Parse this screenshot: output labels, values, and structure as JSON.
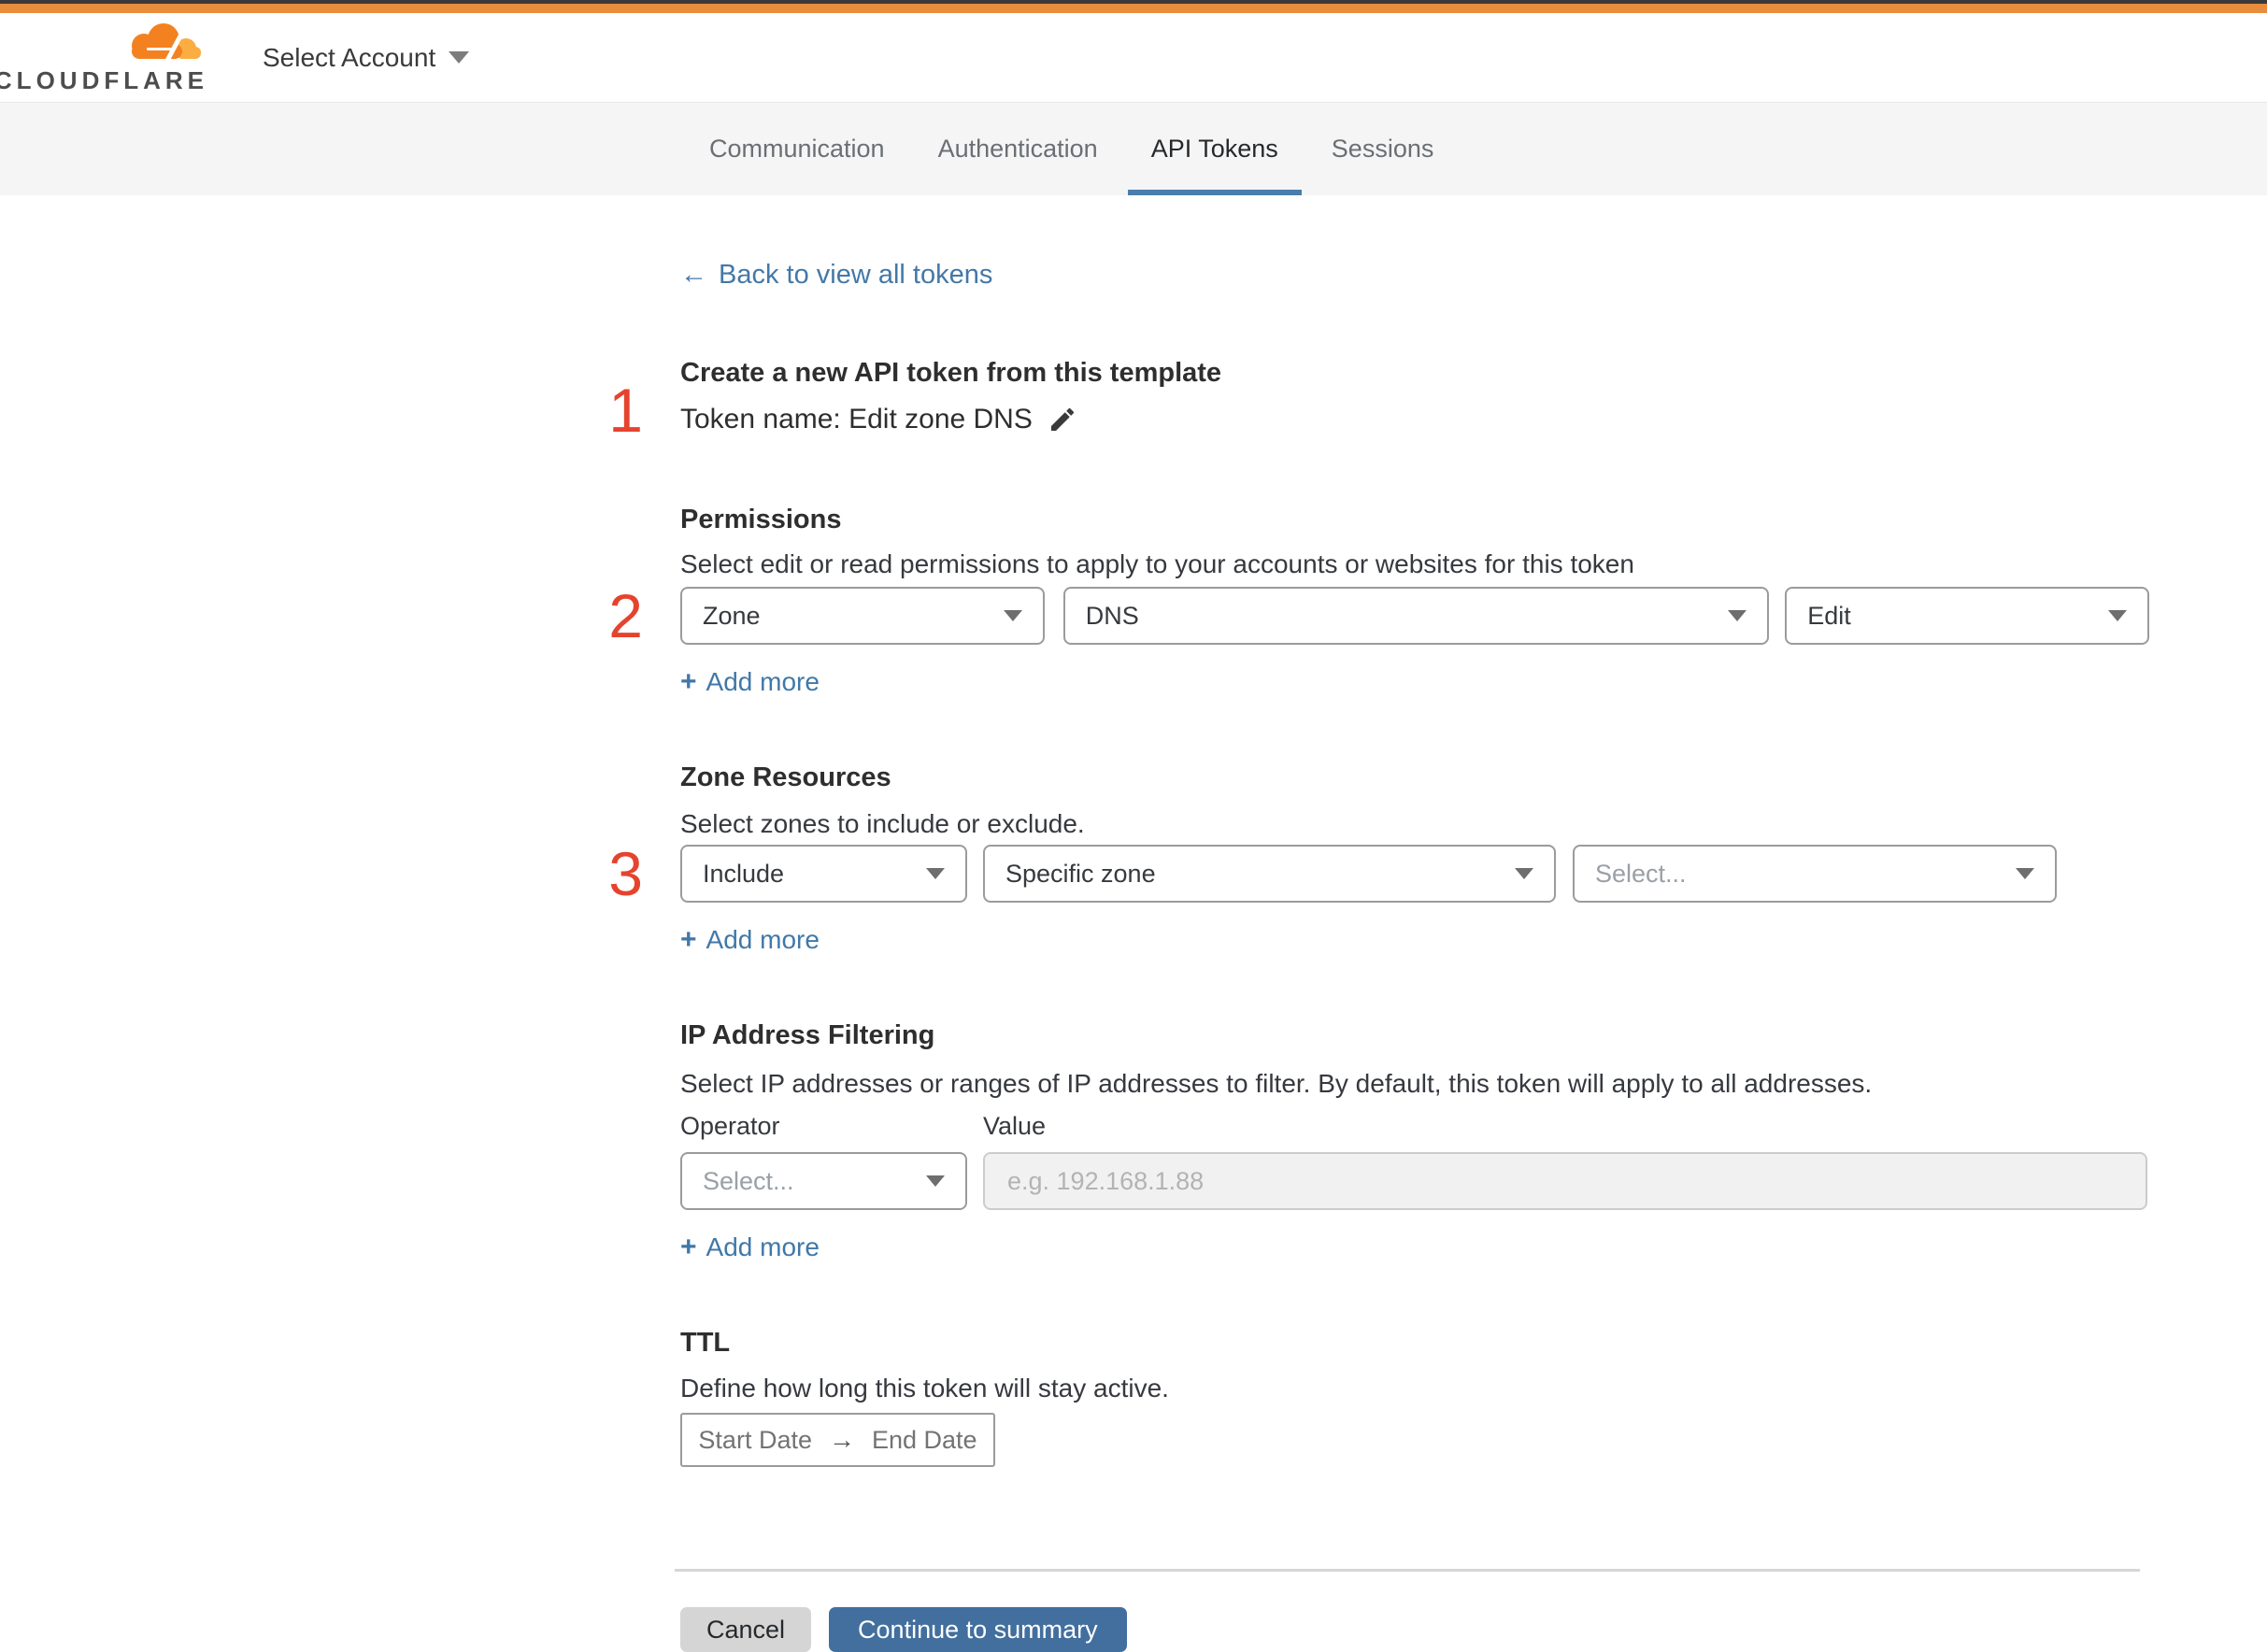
{
  "header": {
    "brand": "CLOUDFLARE",
    "account_selector_label": "Select Account"
  },
  "tabs": [
    {
      "label": "Communication",
      "active": false
    },
    {
      "label": "Authentication",
      "active": false
    },
    {
      "label": "API Tokens",
      "active": true
    },
    {
      "label": "Sessions",
      "active": false
    }
  ],
  "active_tab": "API Tokens",
  "back_link": {
    "arrow": "←",
    "label": "Back to view all tokens"
  },
  "step1": {
    "number": "1",
    "heading": "Create a new API token from this template",
    "token_name_line": "Token name: Edit zone DNS"
  },
  "permissions": {
    "number": "2",
    "heading": "Permissions",
    "description": "Select edit or read permissions to apply to your accounts or websites for this token",
    "selects": [
      {
        "value": "Zone"
      },
      {
        "value": "DNS"
      },
      {
        "value": "Edit"
      }
    ],
    "add_more_label": "Add more"
  },
  "zone_resources": {
    "number": "3",
    "heading": "Zone Resources",
    "description": "Select zones to include or exclude.",
    "selects": [
      {
        "value": "Include"
      },
      {
        "value": "Specific zone"
      },
      {
        "value": "Select...",
        "is_placeholder": true
      }
    ],
    "add_more_label": "Add more"
  },
  "ip_filtering": {
    "heading": "IP Address Filtering",
    "description": "Select IP addresses or ranges of IP addresses to filter. By default, this token will apply to all addresses.",
    "operator_label": "Operator",
    "value_label": "Value",
    "operator_select_value": "Select...",
    "value_input_placeholder": "e.g. 192.168.1.88",
    "add_more_label": "Add more"
  },
  "ttl": {
    "heading": "TTL",
    "description": "Define how long this token will stay active.",
    "start_date_label": "Start Date",
    "range_arrow": "→",
    "end_date_label": "End Date"
  },
  "footer": {
    "cancel_label": "Cancel",
    "continue_label": "Continue to summary"
  },
  "icons": {
    "plus": "+"
  },
  "colors": {
    "topbar_orange": "#e88d3d",
    "topbar_dark": "#3a3a3a",
    "logo_orange": "#f48120",
    "logo_light_orange": "#fbad41",
    "link_blue": "#4478a8",
    "tab_underline_blue": "#4a7dab",
    "primary_button_blue": "#426f9e",
    "step_number_red": "#e5432e",
    "tabbar_background": "#f5f5f6"
  }
}
